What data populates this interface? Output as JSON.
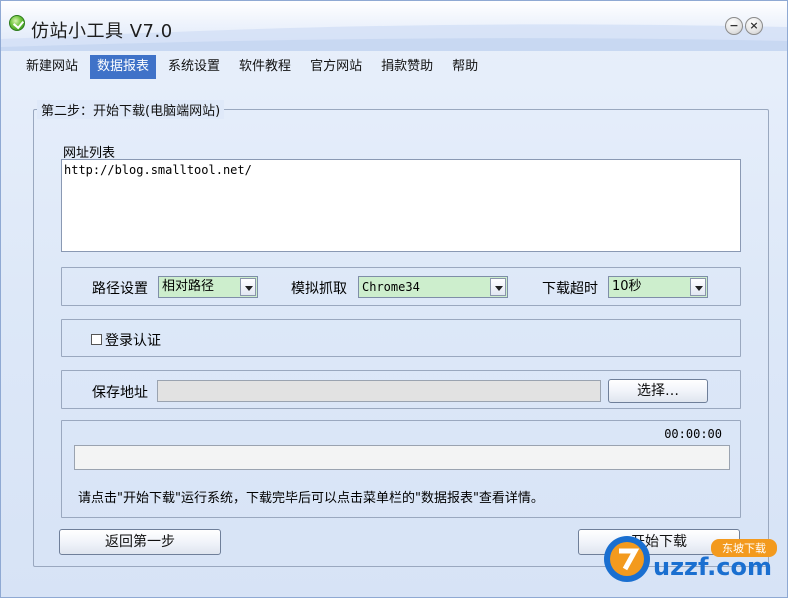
{
  "window": {
    "title": "仿站小工具 V7.0",
    "minimize_glyph": "−",
    "close_glyph": "×",
    "app_icon": "green-check-icon"
  },
  "menu": {
    "items": [
      {
        "label": "新建网站",
        "active": false
      },
      {
        "label": "数据报表",
        "active": true
      },
      {
        "label": "系统设置",
        "active": false
      },
      {
        "label": "软件教程",
        "active": false
      },
      {
        "label": "官方网站",
        "active": false
      },
      {
        "label": "捐款赞助",
        "active": false
      },
      {
        "label": "帮助",
        "active": false
      }
    ]
  },
  "step": {
    "legend": "第二步：开始下载(电脑端网站)",
    "url_list_label": "网址列表",
    "url_list_value": "http://blog.smalltool.net/",
    "path_label": "路径设置",
    "path_value": "相对路径",
    "crawl_label": "模拟抓取",
    "crawl_value": "Chrome34",
    "timeout_label": "下载超时",
    "timeout_value": "10秒",
    "login_label": "登录认证",
    "login_checked": false,
    "save_label": "保存地址",
    "save_value": "",
    "choose_button": "选择…",
    "elapsed": "00:00:00",
    "progress": 0,
    "hint": "请点击\"开始下载\"运行系统，下载完毕后可以点击菜单栏的\"数据报表\"查看详情。",
    "back_button": "返回第一步",
    "start_button": "开始下载"
  },
  "watermark": {
    "brand_text": "uzzf.com",
    "badge_text": "东坡下载"
  },
  "colors": {
    "menu_active": "#3f72c8",
    "combo_bg": "#cdeecd",
    "watermark_orange": "#f39a1e",
    "watermark_blue": "#1a6fd0"
  }
}
